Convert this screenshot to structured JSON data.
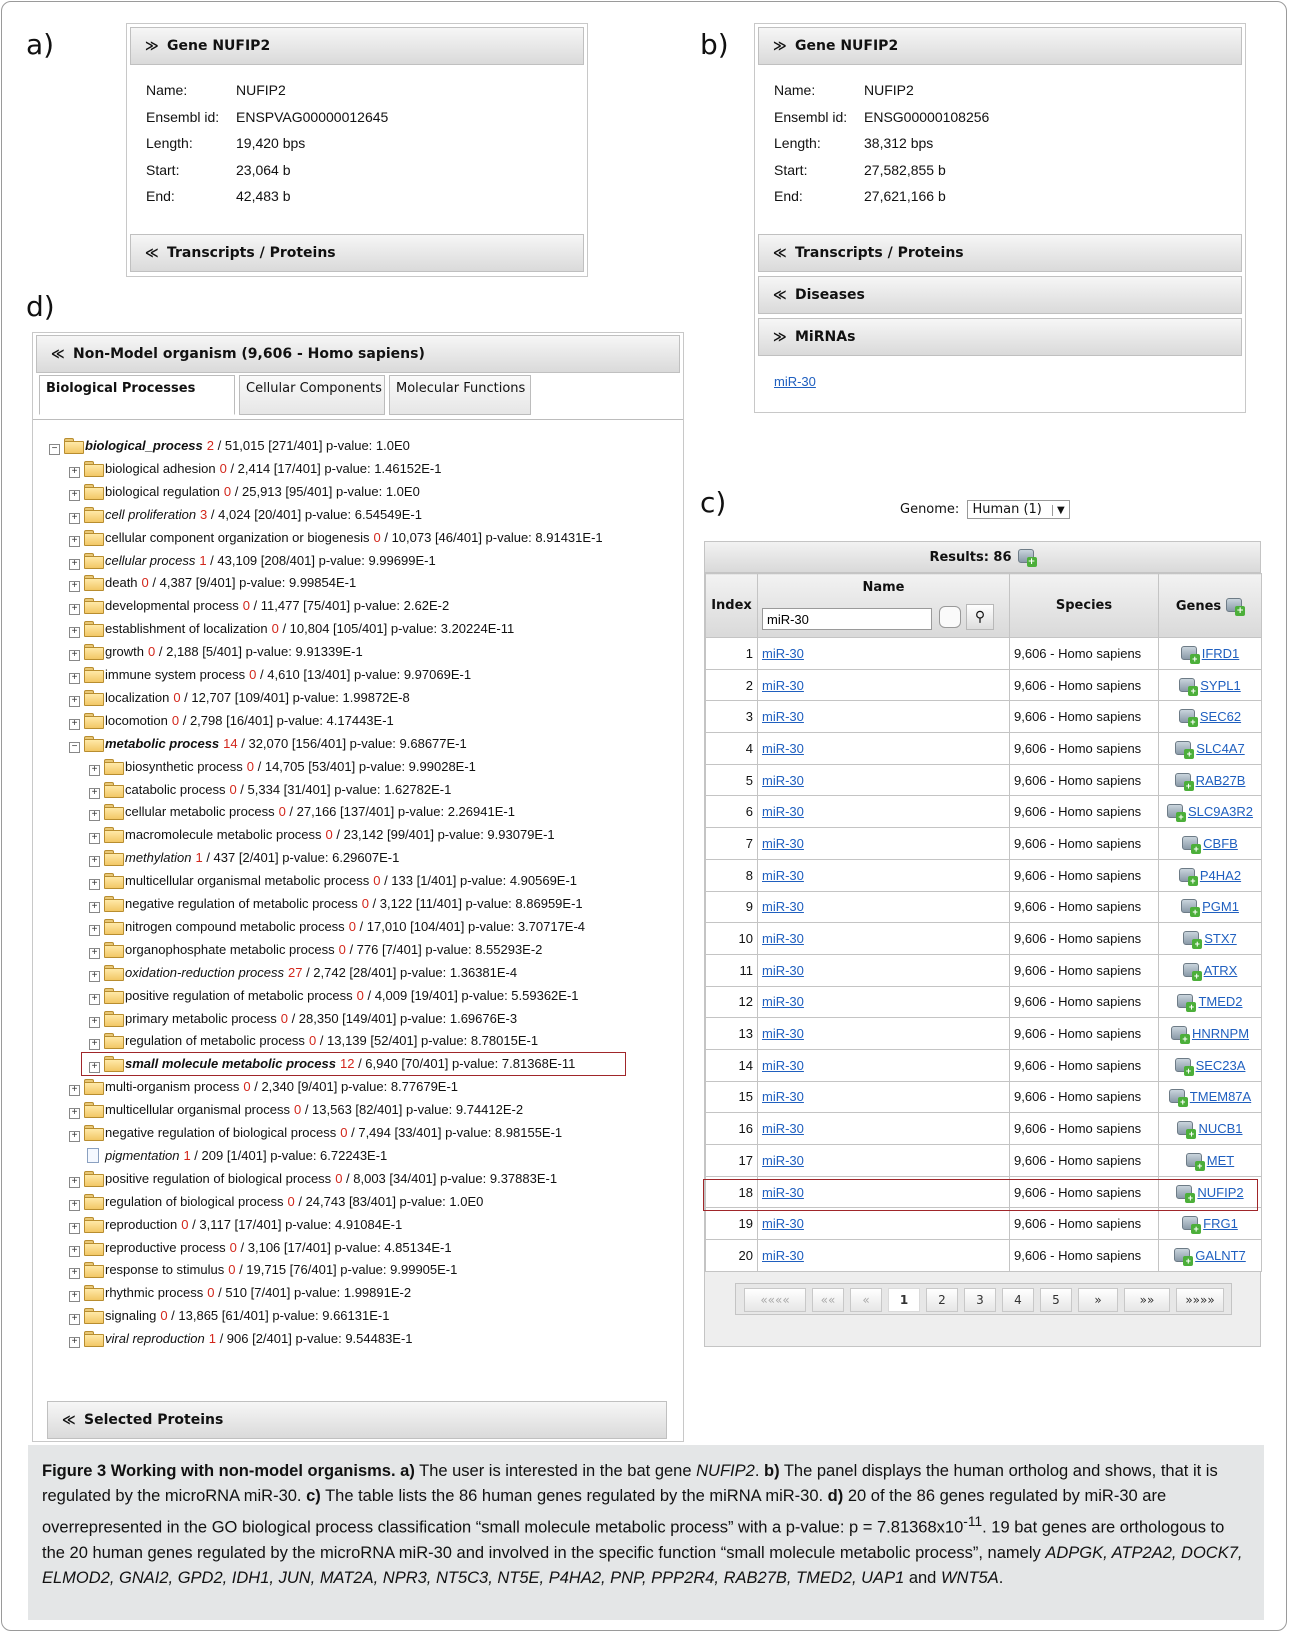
{
  "panel_letters": {
    "a": "a)",
    "b": "b)",
    "c": "c)",
    "d": "d)"
  },
  "panel_a": {
    "header": "Gene NUFIP2",
    "fields": [
      {
        "key": "Name:",
        "value": "NUFIP2"
      },
      {
        "key": "Ensembl id:",
        "value": "ENSPVAG00000012645"
      },
      {
        "key": "Length:",
        "value": "19,420 bps"
      },
      {
        "key": "Start:",
        "value": "23,064 b"
      },
      {
        "key": "End:",
        "value": "42,483 b"
      }
    ],
    "transcripts_header": "Transcripts / Proteins"
  },
  "panel_b": {
    "header": "Gene NUFIP2",
    "fields": [
      {
        "key": "Name:",
        "value": "NUFIP2"
      },
      {
        "key": "Ensembl id:",
        "value": "ENSG00000108256"
      },
      {
        "key": "Length:",
        "value": "38,312 bps"
      },
      {
        "key": "Start:",
        "value": "27,582,855 b"
      },
      {
        "key": "End:",
        "value": "27,621,166 b"
      }
    ],
    "transcripts_header": "Transcripts / Proteins",
    "diseases_header": "Diseases",
    "mirnas_header": "MiRNAs",
    "mirna_link": "miR-30"
  },
  "panel_c": {
    "genome_label": "Genome:",
    "genome_value": "Human (1)",
    "results_label": "Results: 86",
    "headers": {
      "index": "Index",
      "name": "Name",
      "species": "Species",
      "genes": "Genes"
    },
    "filter_value": "miR-30",
    "rows": [
      {
        "index": "1",
        "name": "miR-30",
        "species": "9,606 - Homo sapiens",
        "gene": "IFRD1"
      },
      {
        "index": "2",
        "name": "miR-30",
        "species": "9,606 - Homo sapiens",
        "gene": "SYPL1"
      },
      {
        "index": "3",
        "name": "miR-30",
        "species": "9,606 - Homo sapiens",
        "gene": "SEC62"
      },
      {
        "index": "4",
        "name": "miR-30",
        "species": "9,606 - Homo sapiens",
        "gene": "SLC4A7"
      },
      {
        "index": "5",
        "name": "miR-30",
        "species": "9,606 - Homo sapiens",
        "gene": "RAB27B"
      },
      {
        "index": "6",
        "name": "miR-30",
        "species": "9,606 - Homo sapiens",
        "gene": "SLC9A3R2"
      },
      {
        "index": "7",
        "name": "miR-30",
        "species": "9,606 - Homo sapiens",
        "gene": "CBFB"
      },
      {
        "index": "8",
        "name": "miR-30",
        "species": "9,606 - Homo sapiens",
        "gene": "P4HA2"
      },
      {
        "index": "9",
        "name": "miR-30",
        "species": "9,606 - Homo sapiens",
        "gene": "PGM1"
      },
      {
        "index": "10",
        "name": "miR-30",
        "species": "9,606 - Homo sapiens",
        "gene": "STX7"
      },
      {
        "index": "11",
        "name": "miR-30",
        "species": "9,606 - Homo sapiens",
        "gene": "ATRX"
      },
      {
        "index": "12",
        "name": "miR-30",
        "species": "9,606 - Homo sapiens",
        "gene": "TMED2"
      },
      {
        "index": "13",
        "name": "miR-30",
        "species": "9,606 - Homo sapiens",
        "gene": "HNRNPM"
      },
      {
        "index": "14",
        "name": "miR-30",
        "species": "9,606 - Homo sapiens",
        "gene": "SEC23A"
      },
      {
        "index": "15",
        "name": "miR-30",
        "species": "9,606 - Homo sapiens",
        "gene": "TMEM87A"
      },
      {
        "index": "16",
        "name": "miR-30",
        "species": "9,606 - Homo sapiens",
        "gene": "NUCB1"
      },
      {
        "index": "17",
        "name": "miR-30",
        "species": "9,606 - Homo sapiens",
        "gene": "MET"
      },
      {
        "index": "18",
        "name": "miR-30",
        "species": "9,606 - Homo sapiens",
        "gene": "NUFIP2"
      },
      {
        "index": "19",
        "name": "miR-30",
        "species": "9,606 - Homo sapiens",
        "gene": "FRG1"
      },
      {
        "index": "20",
        "name": "miR-30",
        "species": "9,606 - Homo sapiens",
        "gene": "GALNT7"
      }
    ],
    "highlighted_row": "18",
    "pager": [
      "««««",
      "««",
      "«",
      "1",
      "2",
      "3",
      "4",
      "5",
      "»",
      "»»",
      "»»»»"
    ],
    "current_page": "1"
  },
  "panel_d": {
    "header": "Non-Model organism (9,606 - Homo sapiens)",
    "tabs": [
      "Biological Processes",
      "Cellular Components",
      "Molecular Functions"
    ],
    "active_tab": "Biological Processes",
    "tree": [
      {
        "level": 0,
        "pm": "−",
        "icon": "folder",
        "style": "bold",
        "label": "biological_process",
        "count": "2",
        "rest": " / 51,015 [271/401] p-value: 1.0E0"
      },
      {
        "level": 1,
        "pm": "+",
        "icon": "folder",
        "style": "",
        "label": "biological adhesion",
        "count": "0",
        "rest": " / 2,414 [17/401] p-value: 1.46152E-1"
      },
      {
        "level": 1,
        "pm": "+",
        "icon": "folder",
        "style": "",
        "label": "biological regulation",
        "count": "0",
        "rest": " / 25,913 [95/401] p-value: 1.0E0"
      },
      {
        "level": 1,
        "pm": "+",
        "icon": "folder",
        "style": "ital",
        "label": "cell proliferation",
        "count": "3",
        "rest": " / 4,024 [20/401] p-value: 6.54549E-1"
      },
      {
        "level": 1,
        "pm": "+",
        "icon": "folder",
        "style": "",
        "label": "cellular component organization or biogenesis",
        "count": "0",
        "rest": " / 10,073 [46/401] p-value: 8.91431E-1"
      },
      {
        "level": 1,
        "pm": "+",
        "icon": "folder",
        "style": "ital",
        "label": "cellular process",
        "count": "1",
        "rest": " / 43,109 [208/401] p-value: 9.99699E-1"
      },
      {
        "level": 1,
        "pm": "+",
        "icon": "folder",
        "style": "",
        "label": "death",
        "count": "0",
        "rest": " / 4,387 [9/401] p-value: 9.99854E-1"
      },
      {
        "level": 1,
        "pm": "+",
        "icon": "folder",
        "style": "",
        "label": "developmental process",
        "count": "0",
        "rest": " / 11,477 [75/401] p-value: 2.62E-2"
      },
      {
        "level": 1,
        "pm": "+",
        "icon": "folder",
        "style": "",
        "label": "establishment of localization",
        "count": "0",
        "rest": " / 10,804 [105/401] p-value: 3.20224E-11"
      },
      {
        "level": 1,
        "pm": "+",
        "icon": "folder",
        "style": "",
        "label": "growth",
        "count": "0",
        "rest": " / 2,188 [5/401] p-value: 9.91339E-1"
      },
      {
        "level": 1,
        "pm": "+",
        "icon": "folder",
        "style": "",
        "label": "immune system process",
        "count": "0",
        "rest": " / 4,610 [13/401] p-value: 9.97069E-1"
      },
      {
        "level": 1,
        "pm": "+",
        "icon": "folder",
        "style": "",
        "label": "localization",
        "count": "0",
        "rest": " / 12,707 [109/401] p-value: 1.99872E-8"
      },
      {
        "level": 1,
        "pm": "+",
        "icon": "folder",
        "style": "",
        "label": "locomotion",
        "count": "0",
        "rest": " / 2,798 [16/401] p-value: 4.17443E-1"
      },
      {
        "level": 1,
        "pm": "−",
        "icon": "folder",
        "style": "bold",
        "label": "metabolic process",
        "count": "14",
        "rest": " / 32,070 [156/401] p-value: 9.68677E-1"
      },
      {
        "level": 2,
        "pm": "+",
        "icon": "folder",
        "style": "",
        "label": "biosynthetic process",
        "count": "0",
        "rest": " / 14,705 [53/401] p-value: 9.99028E-1"
      },
      {
        "level": 2,
        "pm": "+",
        "icon": "folder",
        "style": "",
        "label": "catabolic process",
        "count": "0",
        "rest": " / 5,334 [31/401] p-value: 1.62782E-1"
      },
      {
        "level": 2,
        "pm": "+",
        "icon": "folder",
        "style": "",
        "label": "cellular metabolic process",
        "count": "0",
        "rest": " / 27,166 [137/401] p-value: 2.26941E-1"
      },
      {
        "level": 2,
        "pm": "+",
        "icon": "folder",
        "style": "",
        "label": "macromolecule metabolic process",
        "count": "0",
        "rest": " / 23,142 [99/401] p-value: 9.93079E-1"
      },
      {
        "level": 2,
        "pm": "+",
        "icon": "folder",
        "style": "ital",
        "label": "methylation",
        "count": "1",
        "rest": " / 437 [2/401] p-value: 6.29607E-1"
      },
      {
        "level": 2,
        "pm": "+",
        "icon": "folder",
        "style": "",
        "label": "multicellular organismal metabolic process",
        "count": "0",
        "rest": " / 133 [1/401] p-value: 4.90569E-1"
      },
      {
        "level": 2,
        "pm": "+",
        "icon": "folder",
        "style": "",
        "label": "negative regulation of metabolic process",
        "count": "0",
        "rest": " / 3,122 [11/401] p-value: 8.86959E-1"
      },
      {
        "level": 2,
        "pm": "+",
        "icon": "folder",
        "style": "",
        "label": "nitrogen compound metabolic process",
        "count": "0",
        "rest": " / 17,010 [104/401] p-value: 3.70717E-4"
      },
      {
        "level": 2,
        "pm": "+",
        "icon": "folder",
        "style": "",
        "label": "organophosphate metabolic process",
        "count": "0",
        "rest": " / 776 [7/401] p-value: 8.55293E-2"
      },
      {
        "level": 2,
        "pm": "+",
        "icon": "folder",
        "style": "ital",
        "label": "oxidation-reduction process",
        "count": "27",
        "rest": " / 2,742 [28/401] p-value: 1.36381E-4"
      },
      {
        "level": 2,
        "pm": "+",
        "icon": "folder",
        "style": "",
        "label": "positive regulation of metabolic process",
        "count": "0",
        "rest": " / 4,009 [19/401] p-value: 5.59362E-1"
      },
      {
        "level": 2,
        "pm": "+",
        "icon": "folder",
        "style": "",
        "label": "primary metabolic process",
        "count": "0",
        "rest": " / 28,350 [149/401] p-value: 1.69676E-3"
      },
      {
        "level": 2,
        "pm": "+",
        "icon": "folder",
        "style": "",
        "label": "regulation of metabolic process",
        "count": "0",
        "rest": " / 13,139 [52/401] p-value: 8.78015E-1"
      },
      {
        "level": 2,
        "pm": "+",
        "icon": "folder",
        "style": "bold",
        "label": "small molecule metabolic process",
        "count": "12",
        "rest": " / 6,940 [70/401] p-value: 7.81368E-11",
        "highlight": true
      },
      {
        "level": 1,
        "pm": "+",
        "icon": "folder",
        "style": "",
        "label": "multi-organism process",
        "count": "0",
        "rest": " / 2,340 [9/401] p-value: 8.77679E-1"
      },
      {
        "level": 1,
        "pm": "+",
        "icon": "folder",
        "style": "",
        "label": "multicellular organismal process",
        "count": "0",
        "rest": " / 13,563 [82/401] p-value: 9.74412E-2"
      },
      {
        "level": 1,
        "pm": "+",
        "icon": "folder",
        "style": "",
        "label": "negative regulation of biological process",
        "count": "0",
        "rest": " / 7,494 [33/401] p-value: 8.98155E-1"
      },
      {
        "level": 1,
        "pm": "",
        "icon": "file",
        "style": "ital",
        "label": "pigmentation",
        "count": "1",
        "rest": " / 209 [1/401] p-value: 6.72243E-1"
      },
      {
        "level": 1,
        "pm": "+",
        "icon": "folder",
        "style": "",
        "label": "positive regulation of biological process",
        "count": "0",
        "rest": " / 8,003 [34/401] p-value: 9.37883E-1"
      },
      {
        "level": 1,
        "pm": "+",
        "icon": "folder",
        "style": "",
        "label": "regulation of biological process",
        "count": "0",
        "rest": " / 24,743 [83/401] p-value: 1.0E0"
      },
      {
        "level": 1,
        "pm": "+",
        "icon": "folder",
        "style": "",
        "label": "reproduction",
        "count": "0",
        "rest": " / 3,117 [17/401] p-value: 4.91084E-1"
      },
      {
        "level": 1,
        "pm": "+",
        "icon": "folder",
        "style": "",
        "label": "reproductive process",
        "count": "0",
        "rest": " / 3,106 [17/401] p-value: 4.85134E-1"
      },
      {
        "level": 1,
        "pm": "+",
        "icon": "folder",
        "style": "",
        "label": "response to stimulus",
        "count": "0",
        "rest": " / 19,715 [76/401] p-value: 9.99905E-1"
      },
      {
        "level": 1,
        "pm": "+",
        "icon": "folder",
        "style": "",
        "label": "rhythmic process",
        "count": "0",
        "rest": " / 510 [7/401] p-value: 1.99891E-2"
      },
      {
        "level": 1,
        "pm": "+",
        "icon": "folder",
        "style": "",
        "label": "signaling",
        "count": "0",
        "rest": " / 13,865 [61/401] p-value: 9.66131E-1"
      },
      {
        "level": 1,
        "pm": "+",
        "icon": "folder",
        "style": "ital",
        "label": "viral reproduction",
        "count": "1",
        "rest": " / 906 [2/401] p-value: 9.54483E-1"
      }
    ],
    "selected_proteins_header": "Selected Proteins"
  },
  "caption": {
    "title": "Figure 3 Working with non-model organisms.",
    "a_label": "a)",
    "a_text1": " The user is interested in the bat gene ",
    "a_gene": "NUFIP2",
    "a_text2": ". ",
    "b_label": "b)",
    "b_text": " The panel displays the human ortholog and shows, that it is regulated by the microRNA miR-30. ",
    "c_label": "c)",
    "c_text": " The table lists the 86 human genes regulated by the miRNA miR-30. ",
    "d_label": "d)",
    "d_text1": " 20 of the 86 genes regulated by miR-30 are overrepresented in the GO biological process classification “small molecule metabolic process” with a p-value: p = 7.81368x10",
    "d_exp": "-11",
    "d_text2": ". 19 bat genes are orthologous to the 20 human genes regulated by the microRNA miR-30 and involved in the specific function “small molecule metabolic process”, namely ",
    "gene_list": "ADPGK, ATP2A2, DOCK7, ELMOD2, GNAI2, GPD2, IDH1, JUN, MAT2A, NPR3, NT5C3, NT5E, P4HA2, PNP, PPP2R4, RAB27B, TMED2, UAP1",
    "d_text3": " and ",
    "last_gene": "WNT5A",
    "d_text4": "."
  }
}
